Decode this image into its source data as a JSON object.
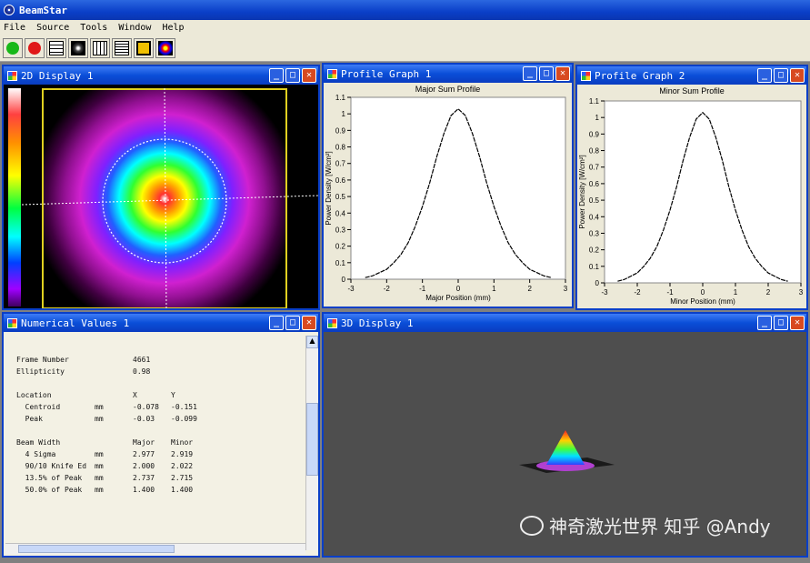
{
  "app": {
    "title": "BeamStar"
  },
  "menu": [
    "File",
    "Source",
    "Tools",
    "Window",
    "Help"
  ],
  "toolbar": {
    "icons": [
      "start-icon",
      "stop-icon",
      "profile-icon",
      "display-2d-icon",
      "grid-icon",
      "numerical-icon",
      "display-3d-icon",
      "beam-icon"
    ]
  },
  "windows": {
    "display2d": {
      "title": "2D Display 1"
    },
    "profile1": {
      "title": "Profile Graph 1",
      "graph_title": "Major Sum Profile"
    },
    "profile2": {
      "title": "Profile Graph 2",
      "graph_title": "Minor Sum Profile"
    },
    "numerical": {
      "title": "Numerical Values 1"
    },
    "display3d": {
      "title": "3D Display 1"
    }
  },
  "chart_data": [
    {
      "type": "line",
      "title": "Major Sum Profile",
      "xlabel": "Major Position (mm)",
      "ylabel": "Power Density [W/cm²]",
      "xlim": [
        -3,
        3
      ],
      "ylim": [
        0,
        1.1
      ],
      "xticks": [
        "-3",
        "-2",
        "-1",
        "0",
        "1",
        "2",
        "3"
      ],
      "yticks": [
        "0",
        "0.1",
        "0.2",
        "0.3",
        "0.4",
        "0.5",
        "0.6",
        "0.7",
        "0.8",
        "0.9",
        "1",
        "1.1"
      ],
      "series": [
        {
          "x": [
            -2.6,
            -2.4,
            -2.2,
            -2.0,
            -1.8,
            -1.6,
            -1.4,
            -1.2,
            -1.0,
            -0.8,
            -0.6,
            -0.4,
            -0.2,
            0,
            0.2,
            0.4,
            0.6,
            0.8,
            1.0,
            1.2,
            1.4,
            1.6,
            1.8,
            2.0,
            2.2,
            2.4,
            2.6
          ],
          "y": [
            0.01,
            0.02,
            0.04,
            0.06,
            0.1,
            0.15,
            0.22,
            0.32,
            0.44,
            0.58,
            0.74,
            0.88,
            0.99,
            1.03,
            0.99,
            0.88,
            0.74,
            0.58,
            0.44,
            0.32,
            0.22,
            0.15,
            0.1,
            0.06,
            0.04,
            0.02,
            0.01
          ]
        }
      ]
    },
    {
      "type": "line",
      "title": "Minor Sum Profile",
      "xlabel": "Minor Position (mm)",
      "ylabel": "Power Density [W/cm²]",
      "xlim": [
        -3,
        3
      ],
      "ylim": [
        0,
        1.1
      ],
      "xticks": [
        "-3",
        "-2",
        "-1",
        "0",
        "1",
        "2",
        "3"
      ],
      "yticks": [
        "0",
        "0.1",
        "0.2",
        "0.3",
        "0.4",
        "0.5",
        "0.6",
        "0.7",
        "0.8",
        "0.9",
        "1",
        "1.1"
      ],
      "series": [
        {
          "x": [
            -2.6,
            -2.4,
            -2.2,
            -2.0,
            -1.8,
            -1.6,
            -1.4,
            -1.2,
            -1.0,
            -0.8,
            -0.6,
            -0.4,
            -0.2,
            0,
            0.2,
            0.4,
            0.6,
            0.8,
            1.0,
            1.2,
            1.4,
            1.6,
            1.8,
            2.0,
            2.2,
            2.4,
            2.6
          ],
          "y": [
            0.01,
            0.02,
            0.04,
            0.06,
            0.1,
            0.15,
            0.22,
            0.32,
            0.44,
            0.58,
            0.74,
            0.88,
            0.99,
            1.03,
            0.99,
            0.88,
            0.74,
            0.58,
            0.44,
            0.32,
            0.22,
            0.15,
            0.1,
            0.06,
            0.04,
            0.02,
            0.01
          ]
        }
      ]
    }
  ],
  "numerical": {
    "rows": [
      {
        "label": "Frame Number",
        "unit": "",
        "v1": "4661",
        "v2": ""
      },
      {
        "label": "Ellipticity",
        "unit": "",
        "v1": "0.98",
        "v2": ""
      },
      {
        "label": "",
        "unit": "",
        "v1": "",
        "v2": ""
      },
      {
        "label": "Location",
        "unit": "",
        "v1": "X",
        "v2": "Y"
      },
      {
        "label": "  Centroid",
        "unit": "mm",
        "v1": "-0.078",
        "v2": "-0.151"
      },
      {
        "label": "  Peak",
        "unit": "mm",
        "v1": "-0.03",
        "v2": "-0.099"
      },
      {
        "label": "",
        "unit": "",
        "v1": "",
        "v2": ""
      },
      {
        "label": "Beam Width",
        "unit": "",
        "v1": "Major",
        "v2": "Minor"
      },
      {
        "label": "  4 Sigma",
        "unit": "mm",
        "v1": "2.977",
        "v2": "2.919"
      },
      {
        "label": "  90/10 Knife Ed",
        "unit": "mm",
        "v1": "2.000",
        "v2": "2.022"
      },
      {
        "label": "  13.5% of Peak",
        "unit": "mm",
        "v1": "2.737",
        "v2": "2.715"
      },
      {
        "label": "  50.0% of Peak",
        "unit": "mm",
        "v1": "1.400",
        "v2": "1.400"
      }
    ]
  },
  "watermark": {
    "text": "神奇激光世界 知乎 @Andy"
  }
}
